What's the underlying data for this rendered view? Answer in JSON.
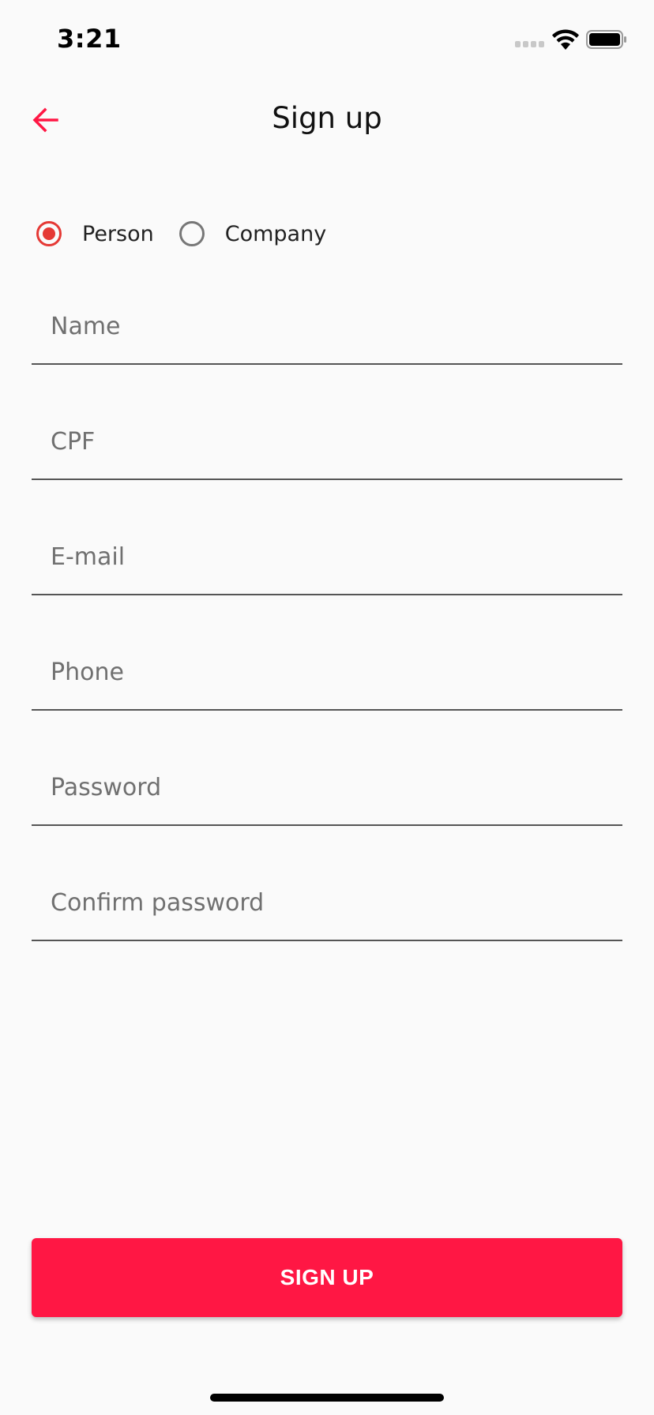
{
  "status_bar": {
    "time": "3:21",
    "icons": [
      "signal-icon",
      "wifi-icon",
      "battery-icon"
    ]
  },
  "header": {
    "title": "Sign up",
    "back_icon": "arrow-left-icon"
  },
  "account_type": {
    "options": [
      {
        "label": "Person",
        "selected": true
      },
      {
        "label": "Company",
        "selected": false
      }
    ]
  },
  "form": {
    "fields": [
      {
        "placeholder": "Name",
        "value": ""
      },
      {
        "placeholder": "CPF",
        "value": ""
      },
      {
        "placeholder": "E-mail",
        "value": ""
      },
      {
        "placeholder": "Phone",
        "value": ""
      },
      {
        "placeholder": "Password",
        "value": ""
      },
      {
        "placeholder": "Confirm password",
        "value": ""
      }
    ]
  },
  "actions": {
    "signup_label": "SIGN UP"
  },
  "colors": {
    "accent": "#ff1744",
    "radio_selected": "#e53935",
    "background": "#fafafa"
  }
}
